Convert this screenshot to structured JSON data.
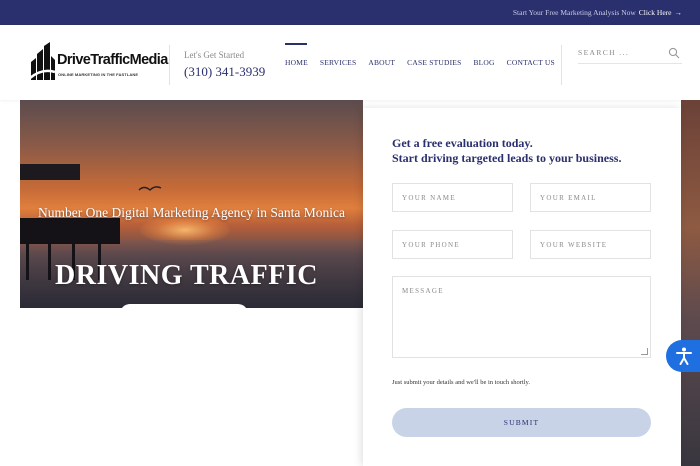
{
  "topbar": {
    "text": "Start Your Free Marketing Analysis Now",
    "link_label": "Click Here",
    "arrow": "→"
  },
  "header": {
    "brand": "DriveTrafficMedia",
    "tagline": "ONLINE MARKETING IN THE FASTLANE",
    "phone_lead": "Let's Get Started",
    "phone_number": "(310) 341-3939",
    "nav": [
      "HOME",
      "SERVICES",
      "ABOUT",
      "CASE STUDIES",
      "BLOG",
      "CONTACT US"
    ],
    "active_nav": "HOME",
    "search_placeholder": "SEARCH ...",
    "icons": {
      "logo": "building-logo-icon",
      "search": "search-icon"
    }
  },
  "hero": {
    "headline": "Number One Digital Marketing Agency in Santa Monica",
    "big_text": "DRIVING TRAFFIC"
  },
  "form": {
    "heading_line1": "Get a free evaluation today.",
    "heading_line2": "Start driving targeted leads to your business.",
    "fields": {
      "name": "YOUR NAME",
      "email": "YOUR EMAIL",
      "phone": "YOUR PHONE",
      "website": "YOUR WEBSITE",
      "message": "MESSAGE"
    },
    "note": "Just submit your details and we'll be in touch shortly.",
    "submit_label": "SUBMIT"
  },
  "accessibility": {
    "icon": "accessibility-icon"
  },
  "colors": {
    "navy": "#2a2f6e",
    "submit_bg": "#c8d3e8",
    "accessibility_blue": "#1f6fe0"
  }
}
